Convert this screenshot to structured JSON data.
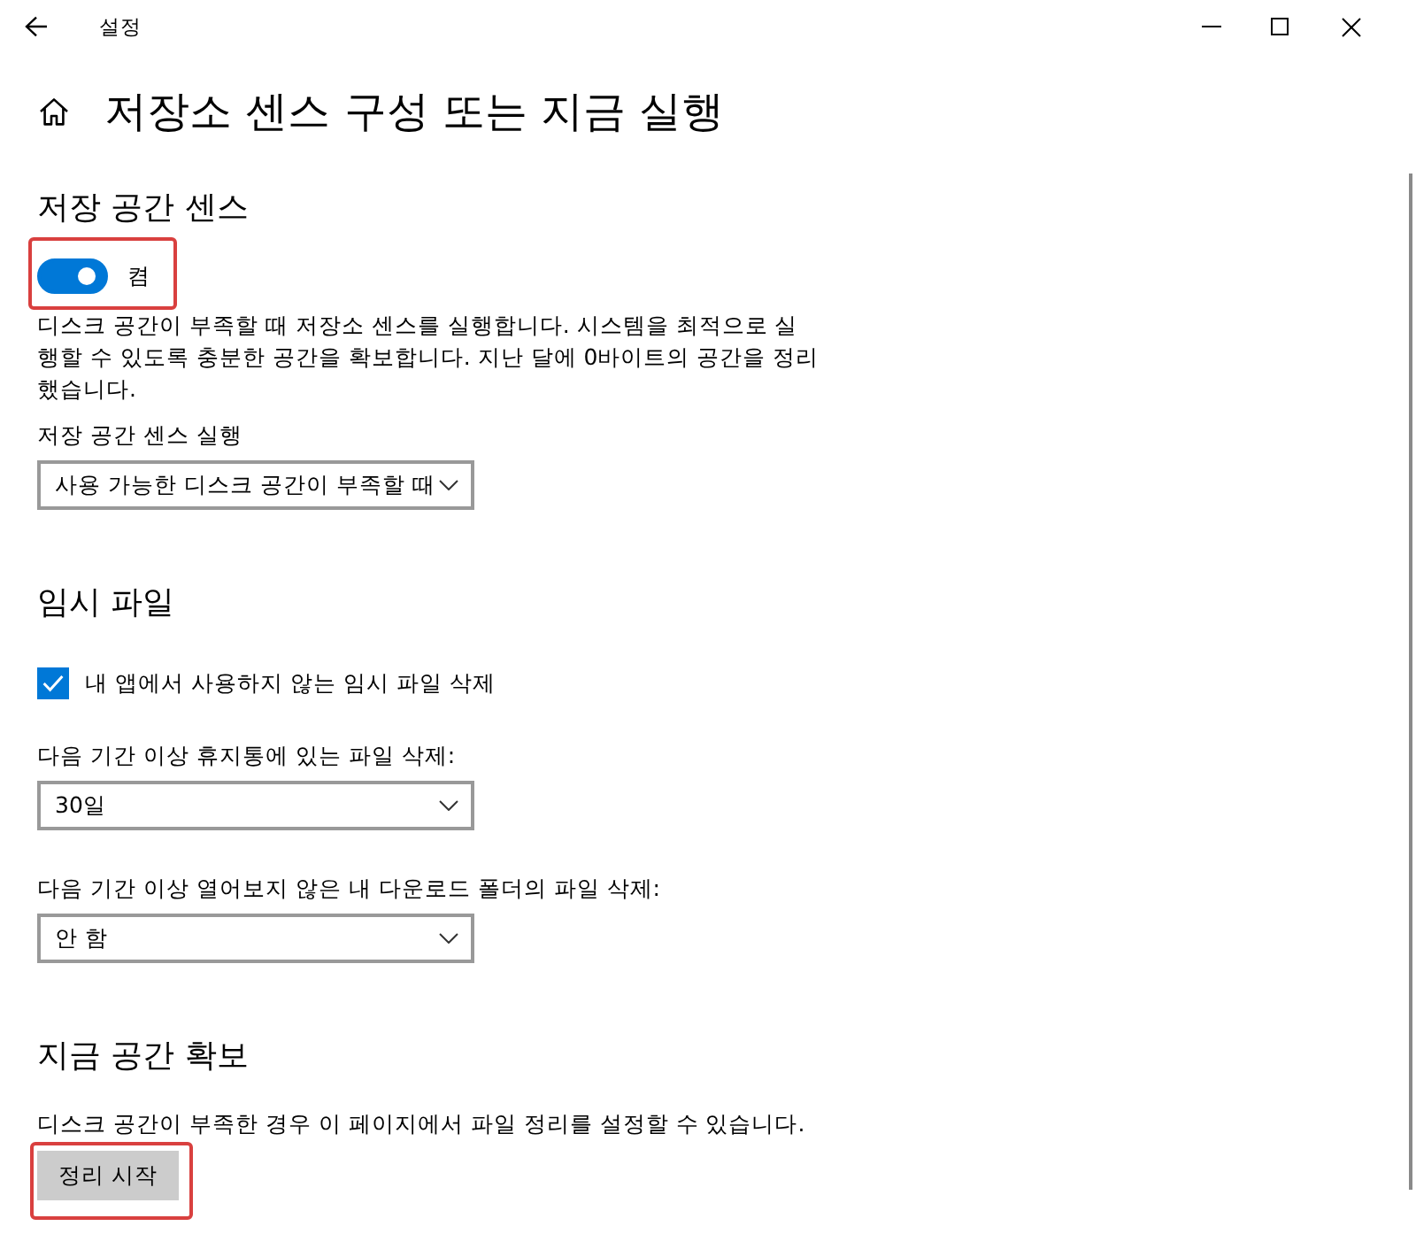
{
  "window": {
    "title": "설정"
  },
  "page": {
    "title": "저장소 센스 구성 또는 지금 실행"
  },
  "sections": [
    {
      "heading": "저장 공간 센스",
      "items": [
        {
          "kind": "toggle",
          "on": true,
          "label": "켬",
          "highlighted": true
        },
        {
          "kind": "text",
          "text": "디스크 공간이 부족할 때 저장소 센스를 실행합니다. 시스템을 최적으로 실행할 수 있도록 충분한 공간을 확보합니다. 지난 달에 0바이트의 공간을 정리했습니다."
        },
        {
          "kind": "label",
          "text": "저장 공간 센스 실행"
        },
        {
          "kind": "dropdown",
          "value": "사용 가능한 디스크 공간이 부족할 때"
        }
      ]
    },
    {
      "heading": "임시 파일",
      "items": [
        {
          "kind": "checkbox",
          "checked": true,
          "label": "내 앱에서 사용하지 않는 임시 파일 삭제"
        },
        {
          "kind": "label",
          "text": "다음 기간 이상 휴지통에 있는 파일 삭제:"
        },
        {
          "kind": "dropdown",
          "value": "30일"
        },
        {
          "kind": "label",
          "text": "다음 기간 이상 열어보지 않은 내 다운로드 폴더의 파일 삭제:"
        },
        {
          "kind": "dropdown",
          "value": "안 함"
        }
      ]
    },
    {
      "heading": "지금 공간 확보",
      "items": [
        {
          "kind": "text",
          "text": "디스크 공간이 부족한 경우 이 페이지에서 파일 정리를 설정할 수 있습니다."
        },
        {
          "kind": "button",
          "label": "정리 시작",
          "highlighted": true
        }
      ]
    }
  ]
}
